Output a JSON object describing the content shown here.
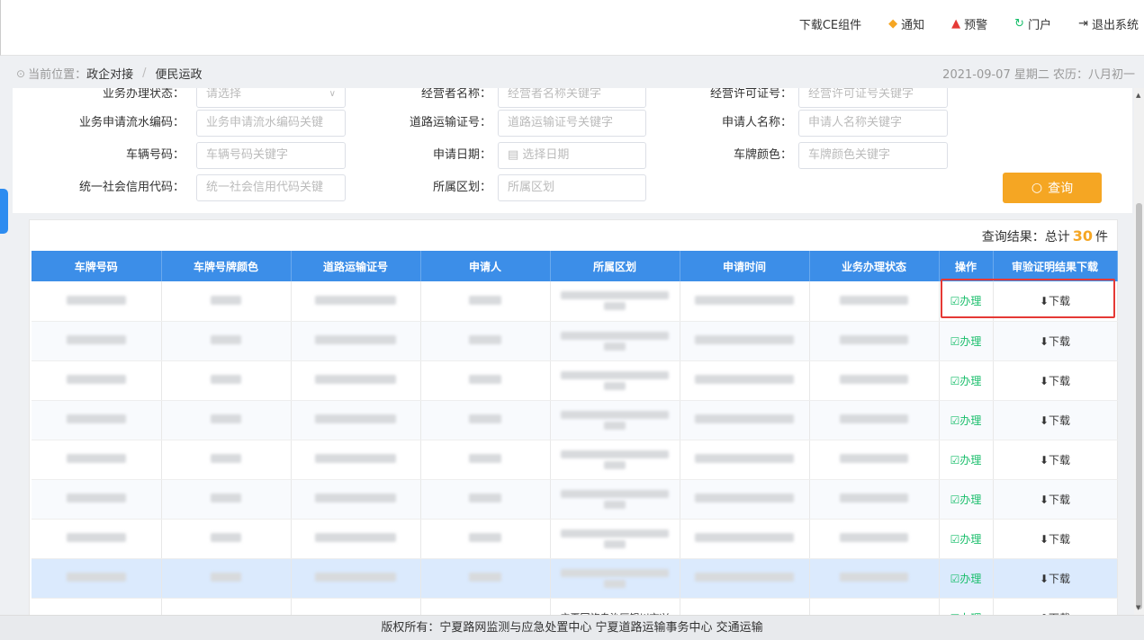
{
  "topnav": [
    {
      "icon": "",
      "label": "下载CE组件",
      "name": "download-ce-link",
      "color": "#333333"
    },
    {
      "icon": "◆",
      "label": "通知",
      "name": "notice-link",
      "color": "#f5a623"
    },
    {
      "icon": "▲",
      "label": "预警",
      "name": "warning-link",
      "color": "#e53935"
    },
    {
      "icon": "↻",
      "label": "门户",
      "name": "portal-link",
      "color": "#19be6b"
    },
    {
      "icon": "⇥",
      "label": "退出系统",
      "name": "logout-link",
      "color": "#333333"
    }
  ],
  "breadcrumb": {
    "prefix": "当前位置：",
    "level1": "政企对接",
    "separator": "/",
    "level2": "便民运政"
  },
  "datebar": "2021-09-07 星期二 农历：八月初一",
  "filters": {
    "row0": [
      {
        "label": "业务办理状态：",
        "placeholder": "请选择",
        "type": "select"
      },
      {
        "label": "经营者名称：",
        "placeholder": "经营者名称关键字"
      },
      {
        "label": "经营许可证号：",
        "placeholder": "经营许可证号关键字"
      }
    ],
    "row1": [
      {
        "label": "业务申请流水编码：",
        "placeholder": "业务申请流水编码关键"
      },
      {
        "label": "道路运输证号：",
        "placeholder": "道路运输证号关键字"
      },
      {
        "label": "申请人名称：",
        "placeholder": "申请人名称关键字"
      }
    ],
    "row2": [
      {
        "label": "车辆号码：",
        "placeholder": "车辆号码关键字"
      },
      {
        "label": "申请日期：",
        "placeholder": "▤ 选择日期"
      },
      {
        "label": "车牌颜色：",
        "placeholder": "车牌颜色关键字"
      }
    ],
    "row3": [
      {
        "label": "统一社会信用代码：",
        "placeholder": "统一社会信用代码关键"
      },
      {
        "label": "所属区划：",
        "placeholder": "所属区划"
      }
    ]
  },
  "search_button": {
    "icon": "○",
    "label": "查询"
  },
  "results": {
    "prefix": "查询结果：总计",
    "count": "30",
    "suffix": "件"
  },
  "table": {
    "headers": [
      "车牌号码",
      "车牌号牌颜色",
      "道路运输证号",
      "申请人",
      "所属区划",
      "申请时间",
      "业务办理状态",
      "操作",
      "审验证明结果下载"
    ],
    "action_label": "☑办理",
    "download_label": "⬇下载",
    "partial_region_text": "宁夏回族自治区银川市兴"
  },
  "footer": "版权所有：宁夏路网监测与应急处置中心 宁夏道路运输事务中心 交通运输",
  "colors": {
    "accent": "#3c8ee8",
    "button": "#f5a623",
    "action": "#19be6b",
    "highlight": "#e53935"
  }
}
